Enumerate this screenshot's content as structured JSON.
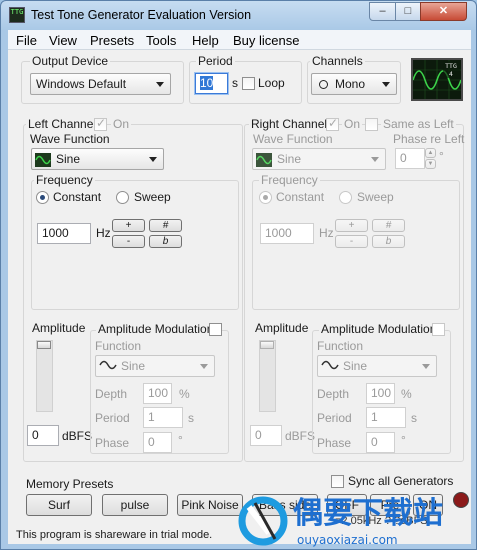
{
  "window": {
    "title": "Test Tone Generator Evaluation Version",
    "icon_text": "TTG",
    "min_glyph": "–",
    "max_glyph": "□",
    "close_glyph": "✕"
  },
  "menu": [
    "File",
    "View",
    "Presets",
    "Tools",
    "Help",
    "Buy license"
  ],
  "output_device": {
    "label": "Output Device",
    "value": "Windows Default"
  },
  "period": {
    "label": "Period",
    "value": "10",
    "unit": "s",
    "loop_label": "Loop"
  },
  "channels": {
    "label": "Channels",
    "value": "Mono"
  },
  "scope_badge": {
    "line1": "TTG",
    "line2": "4"
  },
  "left": {
    "title": "Left Channel",
    "on_label": "On",
    "wave_label": "Wave Function",
    "wave_value": "Sine",
    "freq_label": "Frequency",
    "constant": "Constant",
    "sweep": "Sweep",
    "freq_value": "1000",
    "hz": "Hz",
    "btn_plus": "+",
    "btn_minus": "-",
    "btn_sharp": "#",
    "btn_flat": "b",
    "amp_label": "Amplitude",
    "amp_value": "0",
    "dbfs": "dBFS",
    "mod_label": "Amplitude Modulation",
    "func_label": "Function",
    "func_value": "Sine",
    "depth_label": "Depth",
    "depth_value": "100",
    "depth_unit": "%",
    "period_label": "Period",
    "period_value": "1",
    "period_unit": "s",
    "phase_label": "Phase",
    "phase_value": "0",
    "phase_unit": "°"
  },
  "right": {
    "title": "Right Channel",
    "on_label": "On",
    "same_label": "Same as Left",
    "wave_label": "Wave Function",
    "wave_value": "Sine",
    "phase_re_left_label": "Phase re Left",
    "phase_re_left_value": "0",
    "phase_re_left_unit": "°",
    "freq_label": "Frequency",
    "constant": "Constant",
    "sweep": "Sweep",
    "freq_value": "1000",
    "hz": "Hz",
    "btn_plus": "+",
    "btn_minus": "-",
    "btn_sharp": "#",
    "btn_flat": "b",
    "amp_label": "Amplitude",
    "amp_value": "0",
    "dbfs": "dBFS",
    "mod_label": "Amplitude Modulation",
    "func_label": "Function",
    "func_value": "Sine",
    "depth_label": "Depth",
    "depth_value": "100",
    "depth_unit": "%",
    "period_label": "Period",
    "period_value": "1",
    "period_unit": "s",
    "phase_label": "Phase",
    "phase_value": "0",
    "phase_unit": "°"
  },
  "memory": {
    "label": "Memory Presets",
    "presets": [
      "Surf",
      "pulse",
      "Pink Noise",
      "Bass side"
    ]
  },
  "sync": {
    "label": "Sync all Generators"
  },
  "bottom_buttons": [
    "OFF",
    "Pre",
    "ON"
  ],
  "overlay_text": "=2.05kHz ? ?dBFS",
  "status": "This program is shareware in trial mode.",
  "watermark": {
    "text": "偶要下载站",
    "url": "ouyaoxiazai.com"
  },
  "colors": {
    "accent": "#1e6fd0",
    "scope_green": "#3cd34a",
    "title_bar": "#a9c8e6"
  }
}
